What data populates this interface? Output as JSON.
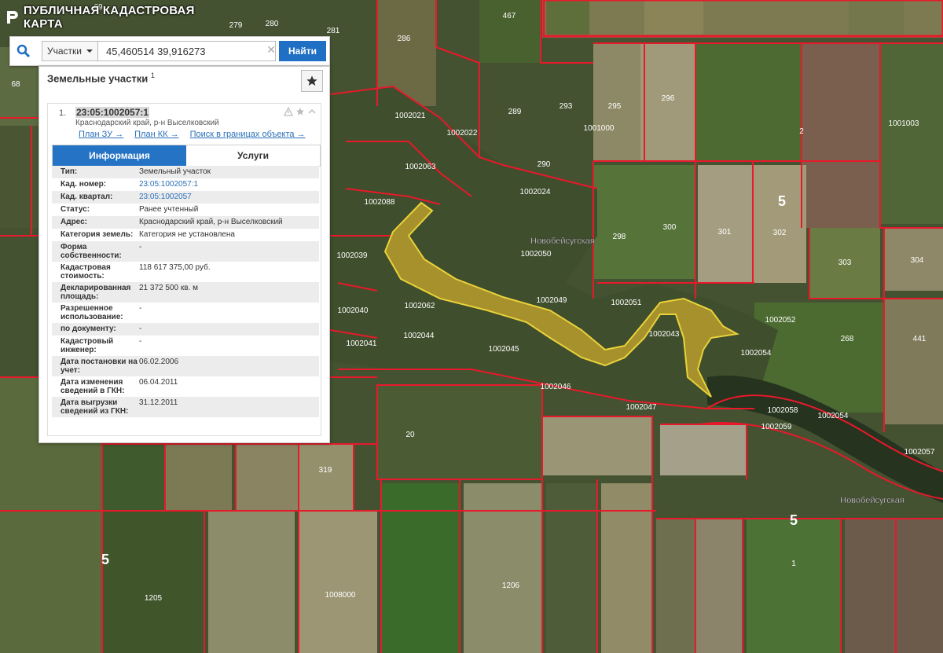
{
  "app": {
    "title": "ПУБЛИЧНАЯ КАДАСТРОВАЯ КАРТА"
  },
  "search": {
    "type_label": "Участки",
    "query": "45,460514 39,916273",
    "button_label": "Найти"
  },
  "panel": {
    "title": "Земельные участки",
    "count": "1",
    "item": {
      "index": "1.",
      "cad_number": "23:05:1002057:1",
      "address": "Краснодарский край, р-н Выселковский",
      "links": [
        "План ЗУ →",
        "План КК →",
        "Поиск в границах объекта →"
      ],
      "tabs": [
        "Информация",
        "Услуги"
      ],
      "fields": [
        {
          "key": "Тип:",
          "value": "Земельный участок"
        },
        {
          "key": "Кад. номер:",
          "value": "23:05:1002057:1",
          "link": true
        },
        {
          "key": "Кад. квартал:",
          "value": "23:05:1002057",
          "link": true
        },
        {
          "key": "Статус:",
          "value": "Ранее учтенный"
        },
        {
          "key": "Адрес:",
          "value": "Краснодарский край, р-н Выселковский"
        },
        {
          "key": "Категория земель:",
          "value": "Категория не установлена"
        },
        {
          "key": "Форма собственности:",
          "value": "-"
        },
        {
          "key": "Кадастровая стоимость:",
          "value": "118 617 375,00 руб."
        },
        {
          "key": "Декларированная площадь:",
          "value": "21 372 500 кв. м"
        },
        {
          "key": "Разрешенное использование:",
          "value": "-"
        },
        {
          "key": "по документу:",
          "value": "-"
        },
        {
          "key": "Кадастровый инженер:",
          "value": "-"
        },
        {
          "key": "Дата постановки на учет:",
          "value": "06.02.2006"
        },
        {
          "key": "Дата изменения сведений в ГКН:",
          "value": "06.04.2011"
        },
        {
          "key": "Дата выгрузки сведений из ГКН:",
          "value": "31.12.2011"
        }
      ]
    }
  },
  "map": {
    "parcel_labels": [
      "69",
      "279",
      "280",
      "281",
      "286",
      "467",
      "68",
      "293",
      "295",
      "296",
      "289",
      "2",
      "1001000",
      "1001003",
      "1002021",
      "1002022",
      "1002063",
      "290",
      "1002024",
      "1002088",
      "1002050",
      "298",
      "300",
      "301",
      "302",
      "303",
      "304",
      "1002039",
      "1002049",
      "1002051",
      "1002052",
      "1002062",
      "1002043",
      "1002040",
      "1002044",
      "1002045",
      "1002054",
      "268",
      "441",
      "1002041",
      "1002046",
      "1002047",
      "1002058",
      "1002059",
      "1002054",
      "1002057",
      "20",
      "319",
      "1206",
      "1205",
      "1008000",
      "1"
    ],
    "district_numbers": [
      "5",
      "5",
      "5"
    ],
    "village_labels": [
      "Новобейсугская",
      "Новобейсугская"
    ],
    "colors": {
      "boundary": "#e8192b",
      "highlight": "#d4b531",
      "accent": "#1f6fc4"
    }
  }
}
